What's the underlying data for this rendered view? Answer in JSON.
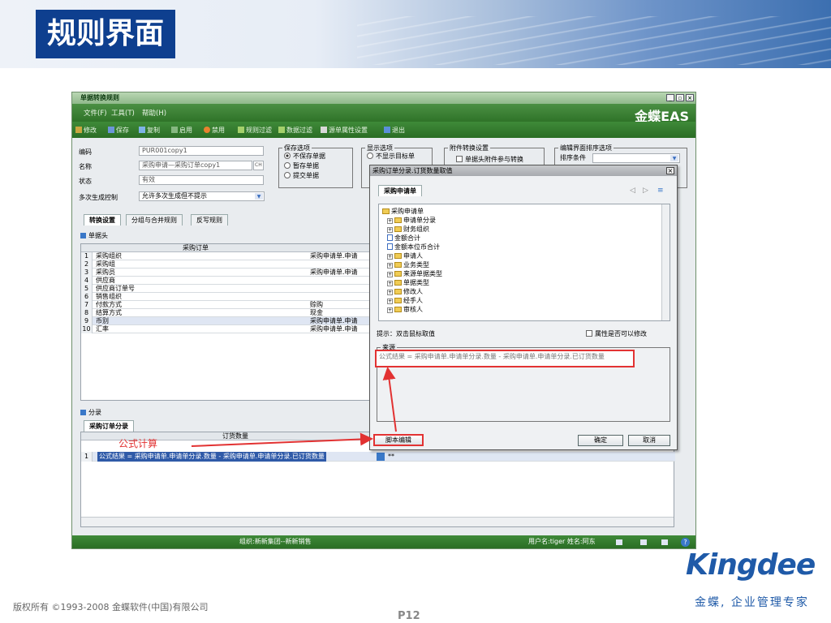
{
  "slide": {
    "title": "规则界面",
    "copyright": "版权所有 ©1993-2008 金蝶软件(中国)有限公司",
    "page_number": "P12",
    "logo_text": "Kingdee",
    "slogan": "金蝶, 企业管理专家",
    "annotation": "公式计算"
  },
  "window": {
    "title": "单据转换规则",
    "controls": [
      "_",
      "▫",
      "×"
    ],
    "brand": "金蝶EAS",
    "menu": [
      "文件(F)",
      "工具(T)",
      "帮助(H)"
    ],
    "toolbar": [
      "修改",
      "保存",
      "复制",
      "启用",
      "禁用",
      "规则过滤",
      "数据过滤",
      "源单属性设置",
      "退出"
    ]
  },
  "form": {
    "code_label": "编码",
    "code_value": "PUR001copy1",
    "name_label": "名称",
    "name_value": "采购申请—采购订单copy1",
    "name_btn": "CH",
    "status_label": "状态",
    "status_value": "有效",
    "multi_label": "多次生成控制",
    "multi_value": "允许多次生成但不提示"
  },
  "save_options": {
    "title": "保存选项",
    "items": [
      "不保存单据",
      "暂存单据",
      "提交单据"
    ]
  },
  "display_options": {
    "title": "显示选项",
    "items": [
      "不显示目标单"
    ]
  },
  "attach_options": {
    "title": "附件转换设置",
    "items": [
      "单据头附件参与转换"
    ]
  },
  "sort_options": {
    "title": "编辑界面排序选项",
    "sort_label": "排序条件"
  },
  "tabs": [
    "转换设置",
    "分组与合并规则",
    "反写规则"
  ],
  "header_section": {
    "title": "单据头",
    "column": "采购订单",
    "rows": [
      {
        "no": "1",
        "field": "采购组织",
        "formula": "采购申请单.申请"
      },
      {
        "no": "2",
        "field": "采购组",
        "formula": ""
      },
      {
        "no": "3",
        "field": "采购员",
        "formula": "采购申请单.申请"
      },
      {
        "no": "4",
        "field": "供应商",
        "formula": ""
      },
      {
        "no": "5",
        "field": "供应商订单号",
        "formula": ""
      },
      {
        "no": "6",
        "field": "销售组织",
        "formula": ""
      },
      {
        "no": "7",
        "field": "付款方式",
        "formula": "赊购"
      },
      {
        "no": "8",
        "field": "结算方式",
        "formula": "现金"
      },
      {
        "no": "9",
        "field": "币别",
        "formula": "采购申请单.申请"
      },
      {
        "no": "10",
        "field": "汇率",
        "formula": "采购申请单.申请"
      }
    ]
  },
  "entry_section": {
    "title": "分录",
    "tab": "采购订单分录",
    "column": "订货数量",
    "rows": [
      {
        "no": "1",
        "formula": "公式结果 = 采购申请单.申请单分录.数量 - 采购申请单.申请单分录.已订货数量",
        "value": "**"
      }
    ]
  },
  "dialog": {
    "title": "采购订单分录.订货数量取值",
    "close": "×",
    "tab": "采购申请单",
    "tree_root": "采购申请单",
    "tree_items": [
      {
        "label": "申请单分录",
        "kind": "folder"
      },
      {
        "label": "财务组织",
        "kind": "folder"
      },
      {
        "label": "金额合计",
        "kind": "doc"
      },
      {
        "label": "金额本位币合计",
        "kind": "doc"
      },
      {
        "label": "申请人",
        "kind": "folder"
      },
      {
        "label": "业务类型",
        "kind": "folder"
      },
      {
        "label": "来源单据类型",
        "kind": "folder"
      },
      {
        "label": "单据类型",
        "kind": "folder"
      },
      {
        "label": "修改人",
        "kind": "folder"
      },
      {
        "label": "经手人",
        "kind": "folder"
      },
      {
        "label": "审核人",
        "kind": "folder"
      }
    ],
    "hint": "提示：双击鼠标取值",
    "editable_label": "属性是否可以修改",
    "source_title": "来源",
    "formula": "公式结果 = 采购申请单.申请单分录.数量 - 采购申请单.申请单分录.已订货数量",
    "script_button": "脚本编辑",
    "ok_button": "确定",
    "cancel_button": "取消"
  },
  "status": {
    "org": "组织:新新集团--新新销售",
    "user": "用户名:tiger 姓名:阿东"
  },
  "colors": {
    "accent_red": "#e23232",
    "brand_blue": "#1f5aa8",
    "bar_green": "#2f7328"
  }
}
